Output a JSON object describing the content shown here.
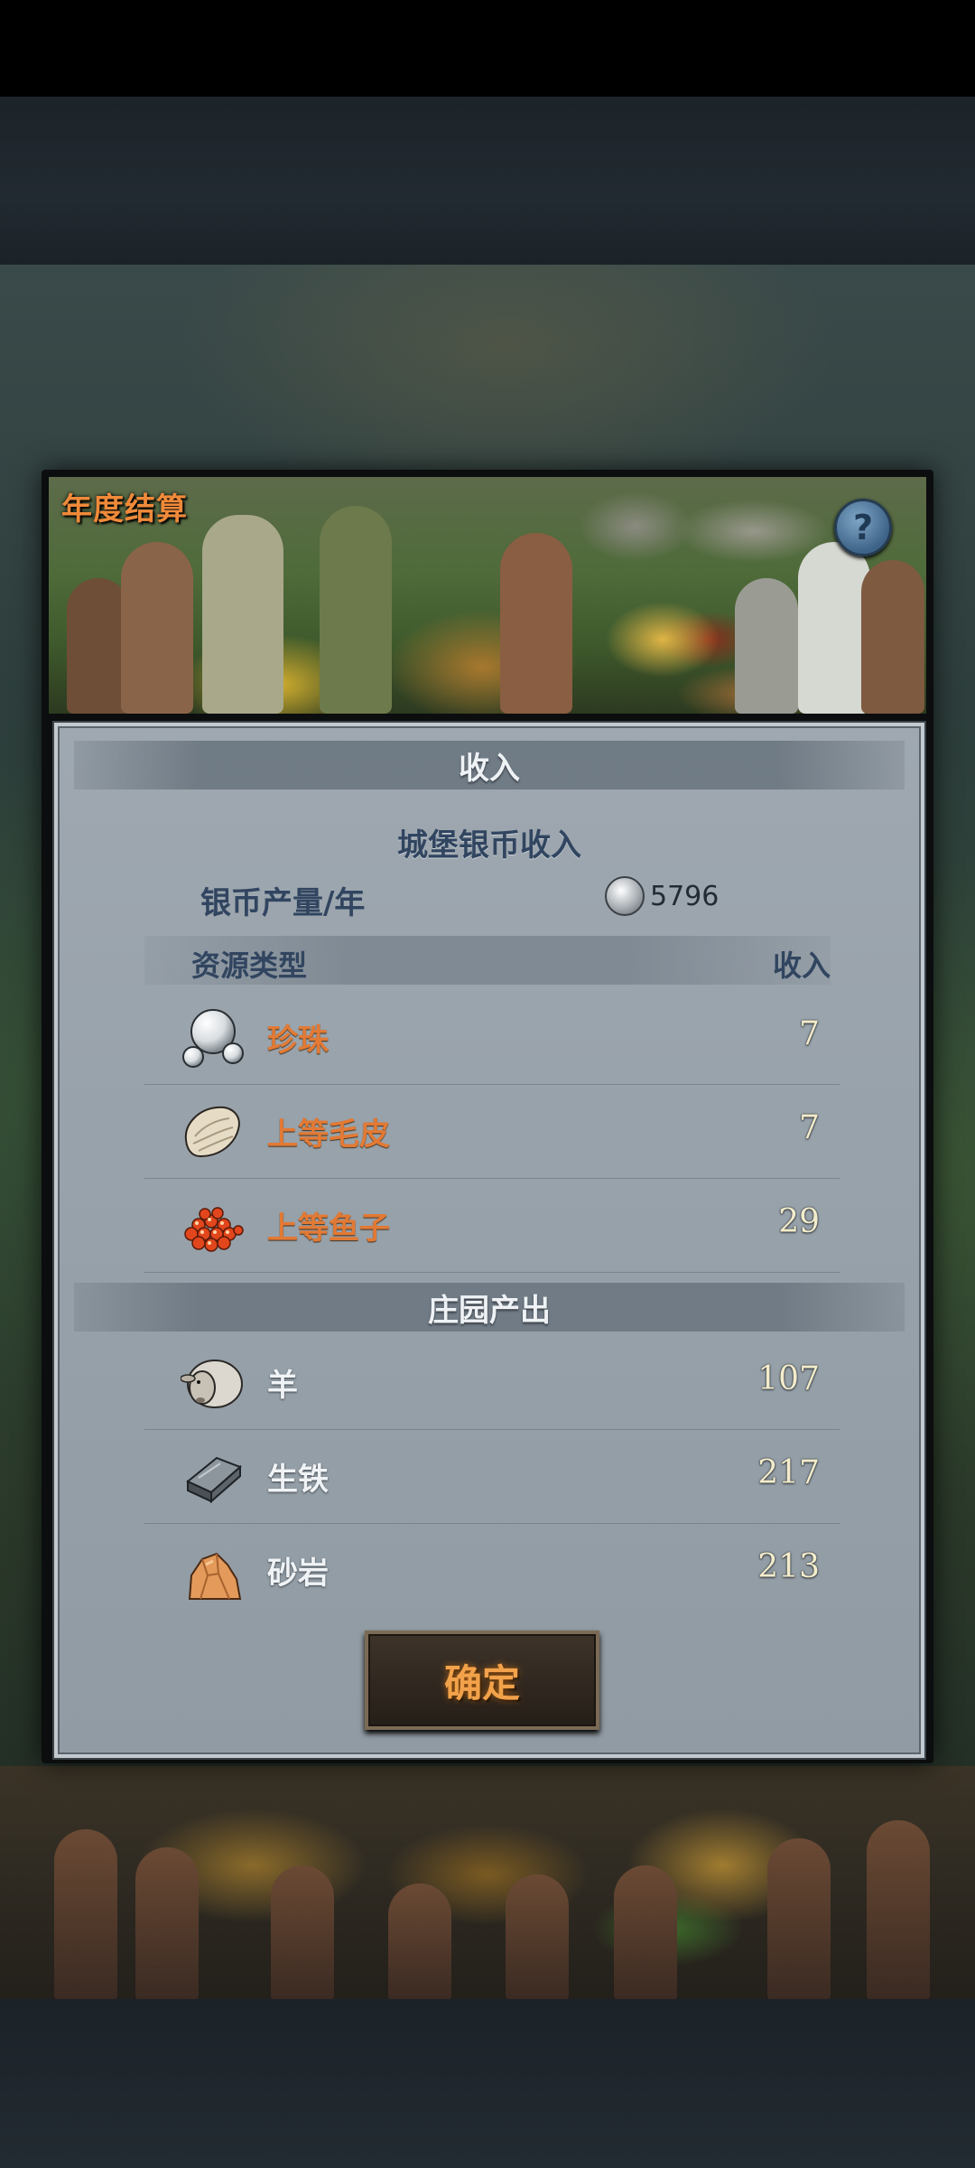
{
  "dialog": {
    "title": "年度结算",
    "help_label": "?"
  },
  "income": {
    "section_title": "收入",
    "castle_title": "城堡银币收入",
    "silver_label": "银币产量/年",
    "silver_value": "5796",
    "table_headers": {
      "type": "资源类型",
      "income": "收入"
    },
    "resources": [
      {
        "name": "珍珠",
        "value": "7",
        "icon": "pearl-icon"
      },
      {
        "name": "上等毛皮",
        "value": "7",
        "icon": "fur-icon"
      },
      {
        "name": "上等鱼子",
        "value": "29",
        "icon": "caviar-icon"
      }
    ]
  },
  "estate": {
    "section_title": "庄园产出",
    "items": [
      {
        "name": "羊",
        "value": "107",
        "icon": "sheep-icon"
      },
      {
        "name": "生铁",
        "value": "217",
        "icon": "pig-iron-icon"
      },
      {
        "name": "砂岩",
        "value": "213",
        "icon": "sandstone-icon"
      }
    ]
  },
  "confirm_label": "确定",
  "colors": {
    "accent_orange": "#e27a35",
    "panel": "#98a2aa",
    "title_blue": "#314560"
  }
}
